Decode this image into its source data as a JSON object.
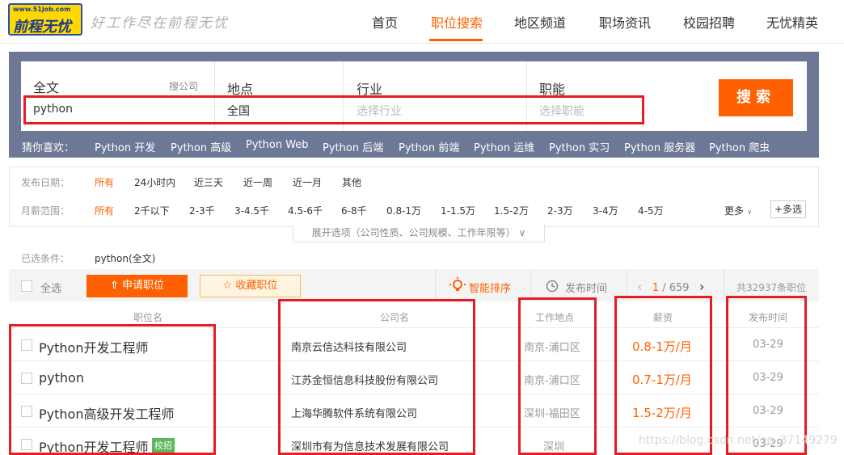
{
  "header": {
    "logo_url": "www.51job.com",
    "logo_brand": "前程无忧",
    "slogan": "好工作尽在前程无忧",
    "nav": [
      "首页",
      "职位搜索",
      "地区频道",
      "职场资讯",
      "校园招聘",
      "无忧精英"
    ],
    "active_nav": "职位搜索",
    "accent": "#ff6000"
  },
  "search": {
    "fulltext_label": "全文",
    "fulltext_hint": "搜公司",
    "fulltext_value": "python",
    "location_label": "地点",
    "location_value": "全国",
    "industry_label": "行业",
    "industry_placeholder": "选择行业",
    "function_label": "职能",
    "function_placeholder": "选择职能",
    "button": "搜索",
    "guess_label": "猜你喜欢：",
    "guesses": [
      "Python 开发",
      "Python 高级",
      "Python Web",
      "Python 后端",
      "Python 前端",
      "Python 运维",
      "Python 实习",
      "Python 服务器",
      "Python 爬虫"
    ]
  },
  "filters": {
    "date_label": "发布日期：",
    "date_options": [
      "所有",
      "24小时内",
      "近三天",
      "近一周",
      "近一月",
      "其他"
    ],
    "salary_label": "月薪范围：",
    "salary_options": [
      "所有",
      "2千以下",
      "2-3千",
      "3-4.5千",
      "4.5-6千",
      "6-8千",
      "0.8-1万",
      "1-1.5万",
      "1.5-2万",
      "2-3万",
      "3-4万",
      "4-5万"
    ],
    "more": "更多",
    "multi": "多选",
    "expand": "展开选项（公司性质、公司规模、工作年限等）"
  },
  "conditions": {
    "label": "已选条件：",
    "value": "python(全文)"
  },
  "toolbar": {
    "select_all": "全选",
    "apply": "申请职位",
    "favorite": "收藏职位",
    "smart_sort": "智能排序",
    "time_sort": "发布时间",
    "page_current": "1",
    "page_total": "/ 659",
    "total": "共32937条职位"
  },
  "table": {
    "headers": [
      "职位名",
      "公司名",
      "工作地点",
      "薪资",
      "发布时间"
    ],
    "rows": [
      {
        "title": "Python开发工程师",
        "company": "南京云信达科技有限公司",
        "location": "南京-浦口区",
        "salary": "0.8-1万/月",
        "date": "03-29"
      },
      {
        "title": "python",
        "company": "江苏金恒信息科技股份有限公司",
        "location": "南京-浦口区",
        "salary": "0.7-1万/月",
        "date": "03-29"
      },
      {
        "title": "Python高级开发工程师",
        "company": "上海华腾软件系统有限公司",
        "location": "深圳-福田区",
        "salary": "1.5-2万/月",
        "date": "03-29"
      },
      {
        "title": "Python开发工程师",
        "company": "深圳市有为信息技术发展有限公司",
        "location": "深圳",
        "salary": "",
        "date": "03-29",
        "tag": "校招"
      }
    ]
  },
  "watermark": "https://blog.csdn.net/qq_37149279"
}
